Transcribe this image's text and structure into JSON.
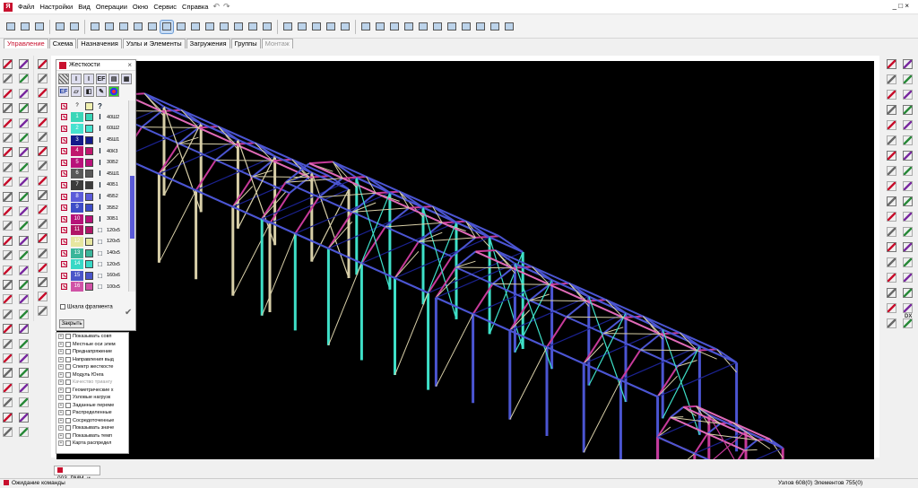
{
  "menu": {
    "items": [
      "Файл",
      "Настройки",
      "Вид",
      "Операции",
      "Окно",
      "Сервис",
      "Справка"
    ],
    "undo": "↶",
    "redo": "↷",
    "window_controls": "_ □ ×"
  },
  "tabs": [
    {
      "label": "Управление",
      "state": "active"
    },
    {
      "label": "Схема",
      "state": "normal"
    },
    {
      "label": "Назначения",
      "state": "normal"
    },
    {
      "label": "Узлы и Элементы",
      "state": "normal"
    },
    {
      "label": "Загружения",
      "state": "normal"
    },
    {
      "label": "Группы",
      "state": "normal"
    },
    {
      "label": "Монтаж",
      "state": "disabled"
    }
  ],
  "stiffness_panel": {
    "title": "Жесткости",
    "close_glyph": "×",
    "header_row": {
      "num": "?",
      "sec": "?"
    },
    "rows": [
      {
        "num": "1",
        "color": "#3ad6b8",
        "sec": "I",
        "val": "40Ш2"
      },
      {
        "num": "2",
        "color": "#46e2cf",
        "sec": "I",
        "val": "60Ш2"
      },
      {
        "num": "3",
        "color": "#131a8a",
        "sec": "I",
        "val": "45Ш1"
      },
      {
        "num": "4",
        "color": "#c0176e",
        "sec": "I",
        "val": "40К3"
      },
      {
        "num": "5",
        "color": "#b8127a",
        "sec": "I",
        "val": "30Б2"
      },
      {
        "num": "6",
        "color": "#585858",
        "sec": "I",
        "val": "45Ш1"
      },
      {
        "num": "7",
        "color": "#3c3c3c",
        "sec": "I",
        "val": "40Б1"
      },
      {
        "num": "8",
        "color": "#5b5bd9",
        "sec": "I",
        "val": "45Б2"
      },
      {
        "num": "9",
        "color": "#3d4cc7",
        "sec": "I",
        "val": "35Б2"
      },
      {
        "num": "10",
        "color": "#b61178",
        "sec": "I",
        "val": "30Б1"
      },
      {
        "num": "11",
        "color": "#b01566",
        "sec": "□",
        "val": "120x5"
      },
      {
        "num": "12",
        "color": "#e6e6a0",
        "sec": "□",
        "val": "120x5"
      },
      {
        "num": "13",
        "color": "#3ab59a",
        "sec": "□",
        "val": "140x5"
      },
      {
        "num": "14",
        "color": "#38d8c6",
        "sec": "□",
        "val": "120x5"
      },
      {
        "num": "15",
        "color": "#4a55c8",
        "sec": "□",
        "val": "160x6"
      },
      {
        "num": "16",
        "color": "#d052a6",
        "sec": "□",
        "val": "100x5"
      }
    ],
    "fragment_scale": "Шкала фрагмента",
    "close_button": "Закрыть",
    "ok_glyph": "✔"
  },
  "flags_list": [
    {
      "label": "Показывать совп",
      "dim": false
    },
    {
      "label": "Местные оси элем",
      "dim": false
    },
    {
      "label": "Преднапряжение",
      "dim": false
    },
    {
      "label": "Направления выд",
      "dim": false
    },
    {
      "label": "Спектр жесткосте",
      "dim": false
    },
    {
      "label": "Модуль Юнга",
      "dim": false
    },
    {
      "label": "Качество триангу",
      "dim": true
    },
    {
      "label": "Геометрические х",
      "dim": false
    },
    {
      "label": "Узловые нагрузк",
      "dim": false
    },
    {
      "label": "Заданные переме",
      "dim": false
    },
    {
      "label": "Распределенные",
      "dim": false
    },
    {
      "label": "Сосредоточенные",
      "dim": false
    },
    {
      "label": "Показывать значе",
      "dim": false
    },
    {
      "label": "Показывать темп",
      "dim": false
    },
    {
      "label": "Карта распредел",
      "dim": false
    }
  ],
  "doc_tab": "003_РММ_и...",
  "status": {
    "left": "Ожидание команды",
    "right": "Узлов 608(0)  Элементов 755(0)"
  },
  "colors": {
    "cyan": "#3ee0c8",
    "blue": "#4b55d2",
    "navy": "#1b2290",
    "magenta": "#c73a9a",
    "pink": "#e06ab8",
    "beige": "#d8cfa8",
    "background": "#000000",
    "brand": "#c8102e"
  }
}
